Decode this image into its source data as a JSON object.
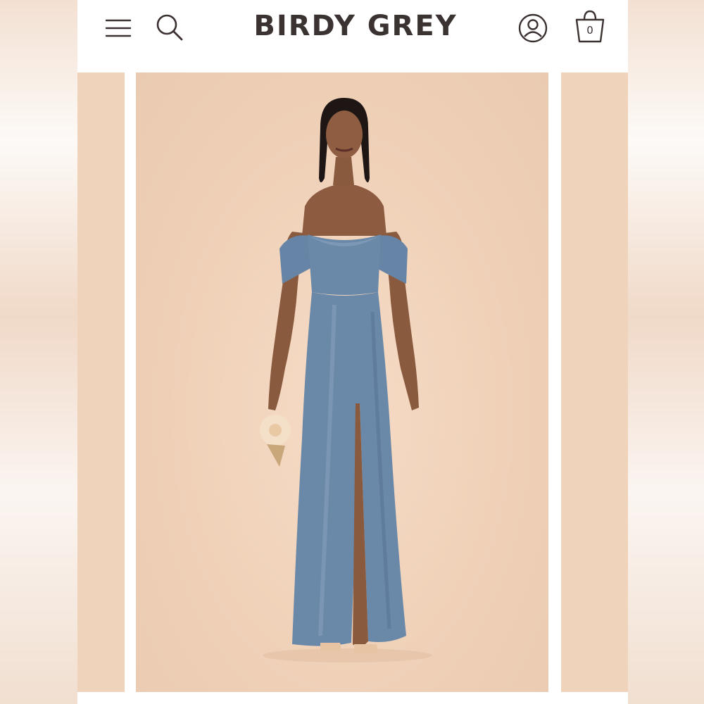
{
  "brand": {
    "logo_text": "BIRDY GREY",
    "text_color": "#3b3232"
  },
  "header": {
    "menu_icon": "hamburger-menu-icon",
    "search_icon": "search-icon",
    "account_icon": "account-icon",
    "bag_icon": "shopping-bag-icon",
    "bag_count": "0"
  },
  "gallery": {
    "background_color": "#efd3bb",
    "dress_color": "#6a88a8"
  }
}
